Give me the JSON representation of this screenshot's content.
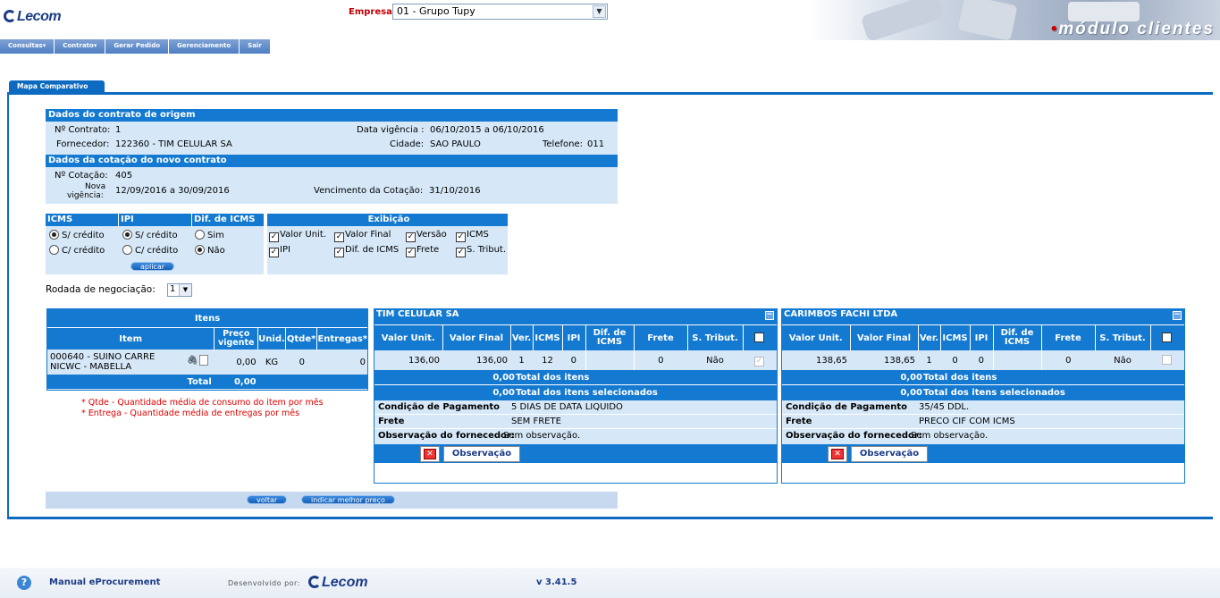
{
  "header": {
    "logo": "Lecom",
    "empresa_label": "Empresa:",
    "empresa_value": "01 - Grupo Tupy",
    "module_title": "módulo clientes"
  },
  "menu": [
    "Consultas",
    "Contrato",
    "Gerar Pedido",
    "Gerenciamento",
    "Sair"
  ],
  "tab": "Mapa Comparativo",
  "origem": {
    "title": "Dados do contrato de origem",
    "contrato_label": "Nº Contrato:",
    "contrato": "1",
    "vigencia_label": "Data vigência :",
    "vigencia": "06/10/2015 a 06/10/2016",
    "fornecedor_label": "Fornecedor:",
    "fornecedor": "122360 - TIM CELULAR SA",
    "cidade_label": "Cidade:",
    "cidade": "SAO PAULO",
    "telefone_label": "Telefone:",
    "telefone": "011"
  },
  "cotacao": {
    "title": "Dados da cotação do novo contrato",
    "cotacao_label": "Nº Cotação:",
    "cotacao": "405",
    "vig_label1": "Nova",
    "vig_label2": "vigência:",
    "vigencia": "12/09/2016 a 30/09/2016",
    "venc_label": "Vencimento da Cotação:",
    "vencimento": "31/10/2016"
  },
  "filtros": {
    "icms": "ICMS",
    "ipi": "IPI",
    "dif": "Dif. de ICMS",
    "s_credito": "S/ crédito",
    "c_credito": "C/ crédito",
    "sim": "Sim",
    "nao": "Não",
    "aplicar": "aplicar"
  },
  "exibicao": {
    "title": "Exibição",
    "opts": [
      "Valor Unit.",
      "Valor Final",
      "Versão",
      "ICMS",
      "IPI",
      "Dif. de ICMS",
      "Frete",
      "S. Tribut."
    ]
  },
  "rodada": {
    "label": "Rodada de negociação:",
    "value": "1"
  },
  "itens": {
    "title": "Itens",
    "h_item": "Item",
    "h_preco": "Preço vigente",
    "h_unid": "Unid.",
    "h_qtde": "Qtde*",
    "h_entregas": "Entregas*",
    "row": {
      "item": "000640 - SUINO CARRE NICWC - MABELLA",
      "preco": "0,00",
      "unid": "KG",
      "qtde": "0",
      "entregas": "0"
    },
    "total_label": "Total",
    "total": "0,00",
    "note1": "* Qtde - Quantidade média de consumo do item por mês",
    "note2": "* Entrega - Quantidade média de entregas por mês"
  },
  "colheads": {
    "vu": "Valor Unit.",
    "vf": "Valor Final",
    "ver": "Ver.",
    "icms": "ICMS",
    "ipi": "IPI",
    "dif": "Dif. de ICMS",
    "frete": "Frete",
    "st": "S. Tribut."
  },
  "labels": {
    "total_itens": "Total dos itens",
    "total_sel": "Total dos itens selecionados",
    "cond": "Condição de Pagamento",
    "frete": "Frete",
    "obs": "Observação do fornecedor:",
    "obs_btn": "Observação"
  },
  "fornecedores": [
    {
      "name": "TIM CELULAR SA",
      "vu": "136,00",
      "vf": "136,00",
      "ver": "1",
      "icms": "12",
      "ipi": "0",
      "dif": "",
      "frete": "0",
      "st": "Não",
      "total_itens": "0,00",
      "total_sel": "0,00",
      "cond": "5 DIAS DE DATA LIQUIDO",
      "frete_txt": "SEM FRETE",
      "obs": "Sem observação."
    },
    {
      "name": "CARIMBOS FACHI LTDA",
      "vu": "138,65",
      "vf": "138,65",
      "ver": "1",
      "icms": "0",
      "ipi": "0",
      "dif": "",
      "frete": "0",
      "st": "Não",
      "total_itens": "0,00",
      "total_sel": "0,00",
      "cond": "35/45 DDL.",
      "frete_txt": "PRECO CIF COM ICMS",
      "obs": "Sem observação."
    }
  ],
  "actions": {
    "voltar": "voltar",
    "melhor": "indicar melhor preço"
  },
  "footer": {
    "manual": "Manual eProcurement",
    "dev": "Desenvolvido por:",
    "logo": "Lecom",
    "version": "v 3.41.5"
  }
}
